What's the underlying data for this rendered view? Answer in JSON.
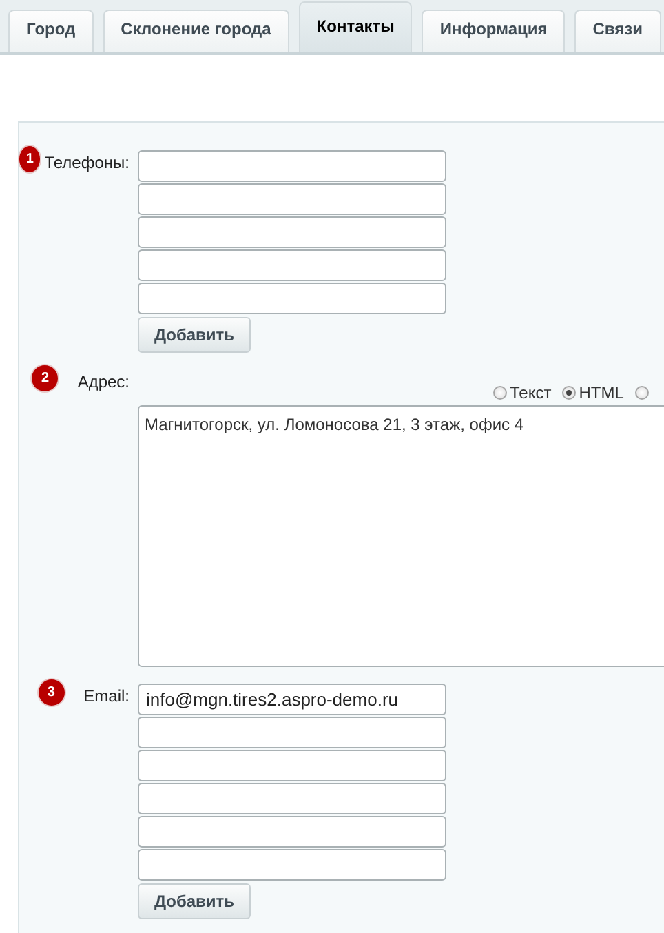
{
  "tabs": [
    {
      "label": "Город",
      "selected": false
    },
    {
      "label": "Склонение города",
      "selected": false
    },
    {
      "label": "Контакты",
      "selected": true
    },
    {
      "label": "Информация",
      "selected": false
    },
    {
      "label": "Связи",
      "selected": false
    }
  ],
  "fields": [
    {
      "kind": "list",
      "badge": "1",
      "label": "Телефоны:",
      "inputs": [
        {
          "kind": "text"
        },
        {
          "kind": "text"
        },
        {
          "kind": "text"
        },
        {
          "kind": "text"
        },
        {
          "kind": "text"
        }
      ],
      "button": "Добавить"
    },
    {
      "kind": "html",
      "badge": "2",
      "label": "Адрес:",
      "modes": [
        {
          "label": "Текст",
          "selected": false
        },
        {
          "label": "HTML",
          "selected": true
        },
        {
          "selected": false
        }
      ],
      "value": "Магнитогорск, ул. Ломоносова 21, 3 этаж, офис 4"
    },
    {
      "kind": "list",
      "badge": "3",
      "label": "Email:",
      "inputs": [
        {
          "kind": "text",
          "value": "info@mgn.tires2.aspro-demo.ru"
        },
        {
          "kind": "text"
        },
        {
          "kind": "text"
        },
        {
          "kind": "text"
        },
        {
          "kind": "text"
        },
        {
          "kind": "text"
        }
      ],
      "button": "Добавить"
    }
  ]
}
